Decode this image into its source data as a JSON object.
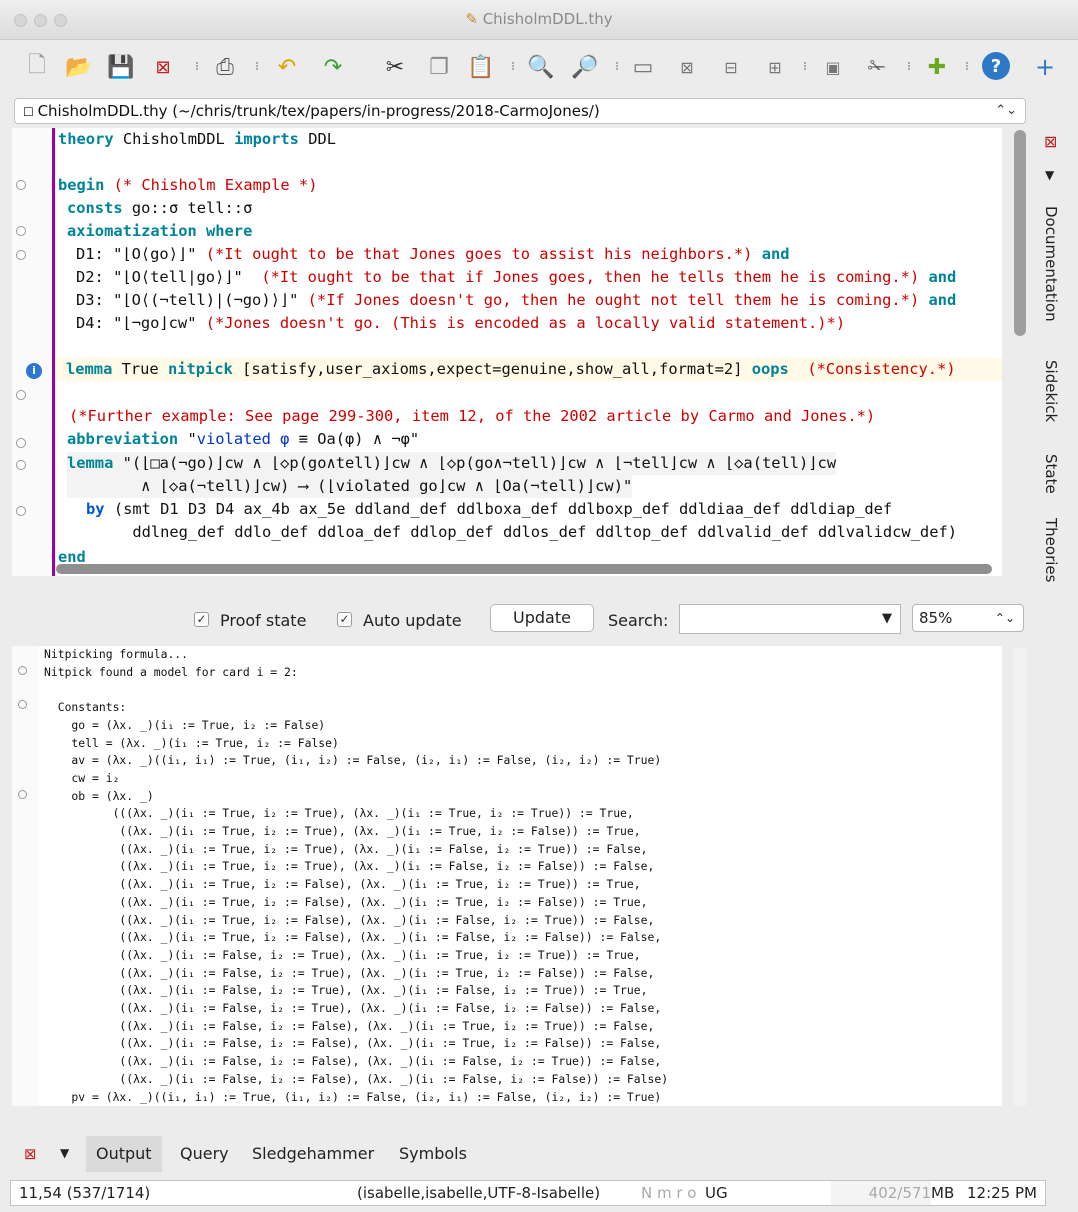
{
  "window": {
    "title": "ChisholmDDL.thy"
  },
  "buffer": {
    "label": "ChisholmDDL.thy (~/chris/trunk/tex/papers/in-progress/2018-CarmoJones/)"
  },
  "editor": {
    "l1_kw": "theory",
    "l1_a": " ChisholmDDL ",
    "l1_kw2": "imports",
    "l1_b": " DDL",
    "l3_kw": "begin",
    "l3_cm": " (* Chisholm Example *)",
    "l4_kw": "consts",
    "l4_t": " go::σ tell::σ",
    "l5_kw": "axiomatization",
    "l5_kw2": " where",
    "l6_t": "D1: \"⌊O⟨go⟩⌋\" ",
    "l6_cm": "(*It ought to be that Jones goes to assist his neighbors.*)",
    "l6_and": " and",
    "l7_t": "D2: \"⌊O⟨tell|go⟩⌋\"  ",
    "l7_cm": "(*It ought to be that if Jones goes, then he tells them he is coming.*)",
    "l7_and": " and",
    "l8_t": "D3: \"⌊O⟨(¬tell)|(¬go)⟩⌋\" ",
    "l8_cm": "(*If Jones doesn't go, then he ought not tell them he is coming.*)",
    "l8_and": " and",
    "l9_t": "D4: \"⌊¬go⌋cw\" ",
    "l9_cm": "(*Jones doesn't go. (This is encoded as a locally valid statement.)*)",
    "l11_kw": "lemma",
    "l11_t": " True ",
    "l11_kw2": "nitpick",
    "l11_t2": " [satisfy,user_axioms,expect=genuine,show_all,format=2] ",
    "l11_kw3": "oops",
    "l11_cm": "  (*Consistency.*)",
    "l13_cm": "(*Further example: See page 299-300, item 12, of the 2002 article by Carmo and Jones.*)",
    "l14_kw": "abbreviation",
    "l14_t": " \"",
    "l14_bl": "violated φ",
    "l14_t2": " ≡ Oa(φ) ∧ ¬φ\"",
    "l15_kw": "lemma",
    "l15_t": " \"(⌊□a(¬go)⌋cw ∧ ⌊◇p(go∧tell)⌋cw ∧ ⌊◇p(go∧¬tell)⌋cw ∧ ⌊¬tell⌋cw ∧ ⌊◇a(tell)⌋cw",
    "l16_t": "        ∧ ⌊◇a(¬tell)⌋cw) ⟶ (⌊violated go⌋cw ∧ ⌊Oa(¬tell)⌋cw)\"",
    "l17_kw": "by",
    "l17_t": " (smt D1 D3 D4 ax_4b ax_5e ddland_def ddlboxa_def ddlboxp_def ddldiaa_def ddldiap_def",
    "l18_t": "     ddlneg_def ddlo_def ddloa_def ddlop_def ddlos_def ddltop_def ddlvalid_def ddlvalidcw_def)",
    "l19_kw": "end"
  },
  "controls": {
    "proof_state": "Proof state",
    "auto_update": "Auto update",
    "update": "Update",
    "search": "Search:",
    "zoom": "85%"
  },
  "output": {
    "lines": [
      "Nitpicking formula...",
      "Nitpick found a model for card i = 2:",
      "",
      "  Constants:",
      "    go = (λx. _)(i₁ := True, i₂ := False)",
      "    tell = (λx. _)(i₁ := True, i₂ := False)",
      "    av = (λx. _)((i₁, i₁) := True, (i₁, i₂) := False, (i₂, i₁) := False, (i₂, i₂) := True)",
      "    cw = i₂",
      "    ob = (λx. _)",
      "          (((λx. _)(i₁ := True, i₂ := True), (λx. _)(i₁ := True, i₂ := True)) := True,",
      "           ((λx. _)(i₁ := True, i₂ := True), (λx. _)(i₁ := True, i₂ := False)) := True,",
      "           ((λx. _)(i₁ := True, i₂ := True), (λx. _)(i₁ := False, i₂ := True)) := False,",
      "           ((λx. _)(i₁ := True, i₂ := True), (λx. _)(i₁ := False, i₂ := False)) := False,",
      "           ((λx. _)(i₁ := True, i₂ := False), (λx. _)(i₁ := True, i₂ := True)) := True,",
      "           ((λx. _)(i₁ := True, i₂ := False), (λx. _)(i₁ := True, i₂ := False)) := True,",
      "           ((λx. _)(i₁ := True, i₂ := False), (λx. _)(i₁ := False, i₂ := True)) := False,",
      "           ((λx. _)(i₁ := True, i₂ := False), (λx. _)(i₁ := False, i₂ := False)) := False,",
      "           ((λx. _)(i₁ := False, i₂ := True), (λx. _)(i₁ := True, i₂ := True)) := True,",
      "           ((λx. _)(i₁ := False, i₂ := True), (λx. _)(i₁ := True, i₂ := False)) := False,",
      "           ((λx. _)(i₁ := False, i₂ := True), (λx. _)(i₁ := False, i₂ := True)) := True,",
      "           ((λx. _)(i₁ := False, i₂ := True), (λx. _)(i₁ := False, i₂ := False)) := False,",
      "           ((λx. _)(i₁ := False, i₂ := False), (λx. _)(i₁ := True, i₂ := True)) := False,",
      "           ((λx. _)(i₁ := False, i₂ := False), (λx. _)(i₁ := True, i₂ := False)) := False,",
      "           ((λx. _)(i₁ := False, i₂ := False), (λx. _)(i₁ := False, i₂ := True)) := False,",
      "           ((λx. _)(i₁ := False, i₂ := False), (λx. _)(i₁ := False, i₂ := False)) := False)",
      "    pv = (λx. _)((i₁, i₁) := True, (i₁, i₂) := False, (i₂, i₁) := False, (i₂, i₂) := True)"
    ]
  },
  "sidebar": {
    "tabs": [
      "Documentation",
      "Sidekick",
      "State",
      "Theories"
    ]
  },
  "bottom_tabs": [
    "Output",
    "Query",
    "Sledgehammer",
    "Symbols"
  ],
  "status": {
    "position": "11,54 (537/1714)",
    "mode": "(isabelle,isabelle,UTF-8-Isabelle)",
    "flags": "N m r o ",
    "ug": "UG",
    "memory": "402/571",
    "mb": "MB",
    "time": "12:25 PM"
  },
  "icons": [
    "new-file-icon",
    "open-folder-icon",
    "save-icon",
    "close-icon",
    "print-icon",
    "undo-icon",
    "redo-icon",
    "cut-icon",
    "copy-icon",
    "paste-icon",
    "find-icon",
    "find-replace-icon",
    "new-view-icon",
    "unsplit-icon",
    "split-horizontal-icon",
    "split-vertical-icon",
    "buffer-options-icon",
    "global-options-icon",
    "plugin-manager-icon",
    "help-icon",
    "add-icon"
  ]
}
